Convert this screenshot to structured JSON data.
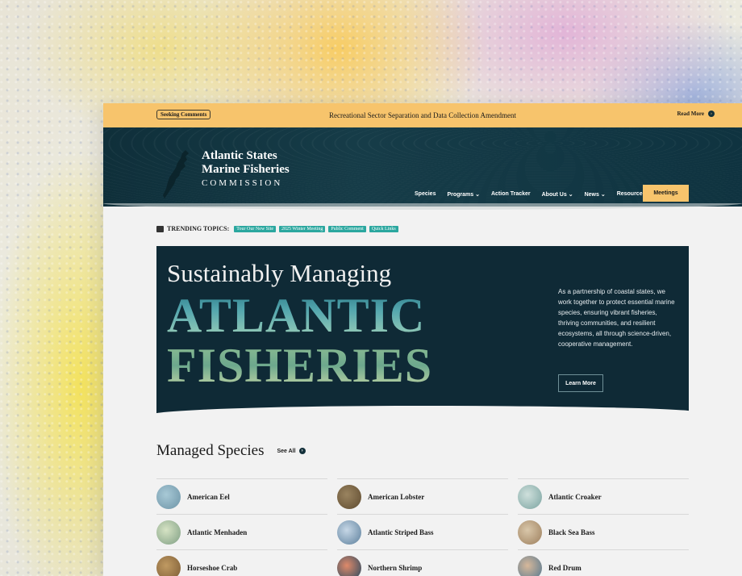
{
  "banner": {
    "tag": "Seeking Comments",
    "title": "Recreational Sector Separation and Data Collection Amendment",
    "read_more": "Read More"
  },
  "header": {
    "logo_line1": "Atlantic States",
    "logo_line2": "Marine Fisheries",
    "logo_line3": "COMMISSION",
    "nav": [
      "Species",
      "Programs",
      "Action Tracker",
      "About Us",
      "News",
      "Resources"
    ],
    "meetings_label": "Meetings"
  },
  "trending": {
    "label": "TRENDING TOPICS:",
    "chips": [
      "Tour Our New Site",
      "2025 Winter Meeting",
      "Public Comment",
      "Quick Links"
    ]
  },
  "hero": {
    "heading": "Sustainably Managing",
    "big1": "ATLANTIC",
    "big2": "FISHERIES",
    "description": "As a partnership of coastal states, we work together to protect essential marine species, ensuring vibrant fisheries, thriving communities, and resilient ecosystems, all through science-driven, cooperative management.",
    "learn_more": "Learn More"
  },
  "species": {
    "title": "Managed Species",
    "see_all": "See All",
    "items": [
      "American Eel",
      "American Lobster",
      "Atlantic Croaker",
      "Atlantic Menhaden",
      "Atlantic Striped Bass",
      "Black Sea Bass",
      "Horseshoe Crab",
      "Northern Shrimp",
      "Red Drum"
    ]
  },
  "colors": {
    "banner": "#f7c46c",
    "header": "#13303a",
    "hero": "#0f2a36",
    "chip": "#2ba79f",
    "button": "#f7c46c"
  },
  "icons": [
    "arrow-right-icon",
    "trending-icon",
    "map-logo-icon",
    "chevron-down-icon"
  ]
}
